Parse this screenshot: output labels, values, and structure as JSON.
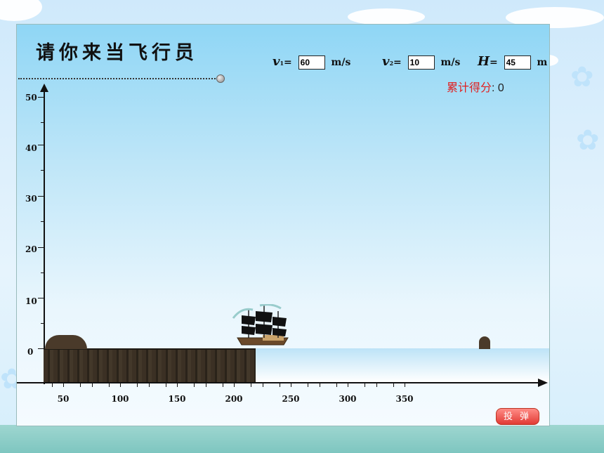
{
  "app": {
    "title": "请你来当飞行员"
  },
  "params": {
    "v1": {
      "symbol": "v",
      "subscript": "1",
      "eq": "=",
      "value": "60",
      "unit": "m/s"
    },
    "v2": {
      "symbol": "v",
      "subscript": "2",
      "eq": "=",
      "value": "10",
      "unit": "m/s"
    },
    "h": {
      "symbol": "H",
      "eq": "=",
      "value": "45",
      "unit": "m"
    }
  },
  "score": {
    "label": "累计得分",
    "separator": ":",
    "value": "0"
  },
  "axes": {
    "y_ticks": [
      "50",
      "40",
      "30",
      "20",
      "10",
      "0"
    ],
    "x_ticks": [
      "50",
      "100",
      "150",
      "200",
      "250",
      "300",
      "350"
    ]
  },
  "actions": {
    "drop_label": "投弹"
  },
  "icons": {
    "ship": "sailing-ship-icon",
    "knob": "slider-knob-icon"
  },
  "colors": {
    "score_label": "#e02020",
    "button": "#e23a34"
  }
}
